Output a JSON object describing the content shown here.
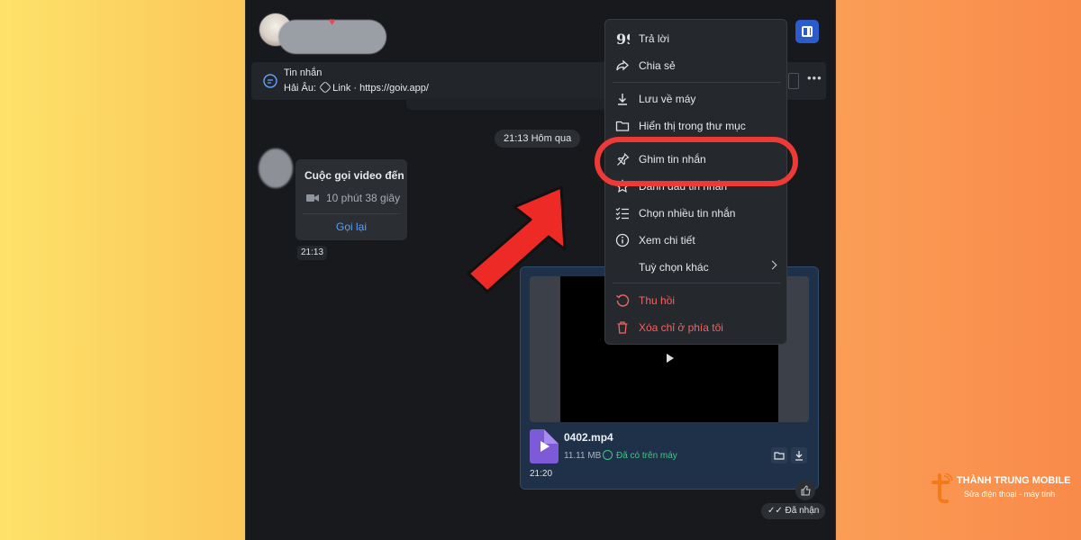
{
  "pinned": {
    "title": "Tin nhắn",
    "sender": "Hải Âu:",
    "link_label": "Link",
    "link_url": "· https://goiv.app/"
  },
  "timeline": {
    "day_separator": "21:13 Hôm qua"
  },
  "call_card": {
    "title": "Cuộc gọi video đến",
    "duration": "10 phút 38 giây",
    "callback_label": "Gọi lại",
    "time": "21:13"
  },
  "video_message": {
    "file_name": "0402.mp4",
    "file_size": "11.11 MB",
    "saved_status": "Đã có trên máy",
    "time": "21:20",
    "delivery_status": "Đã nhận"
  },
  "context_menu": {
    "items": [
      {
        "label": "Trả lời",
        "icon": "quote-icon"
      },
      {
        "label": "Chia sẻ",
        "icon": "share-icon"
      },
      {
        "label": "Lưu về máy",
        "icon": "download-icon"
      },
      {
        "label": "Hiển thị trong thư mục",
        "icon": "folder-icon"
      },
      {
        "label": "Ghim tin nhắn",
        "icon": "pin-icon"
      },
      {
        "label": "Đánh dấu tin nhắn",
        "icon": "star-icon"
      },
      {
        "label": "Chọn nhiều tin nhắn",
        "icon": "checklist-icon"
      },
      {
        "label": "Xem chi tiết",
        "icon": "info-icon"
      },
      {
        "label": "Tuỳ chọn khác",
        "icon": "chevron-right-icon"
      },
      {
        "label": "Thu hồi",
        "icon": "recall-icon"
      },
      {
        "label": "Xóa chỉ ở phía tôi",
        "icon": "trash-icon"
      }
    ]
  },
  "brand": {
    "name": "THÀNH TRUNG MOBILE",
    "tagline": "Sửa điện thoại - máy tính"
  },
  "colors": {
    "accent_blue": "#2b5ccc",
    "danger": "#f06462",
    "highlight_red": "#ee3a36",
    "success": "#46c28a"
  }
}
